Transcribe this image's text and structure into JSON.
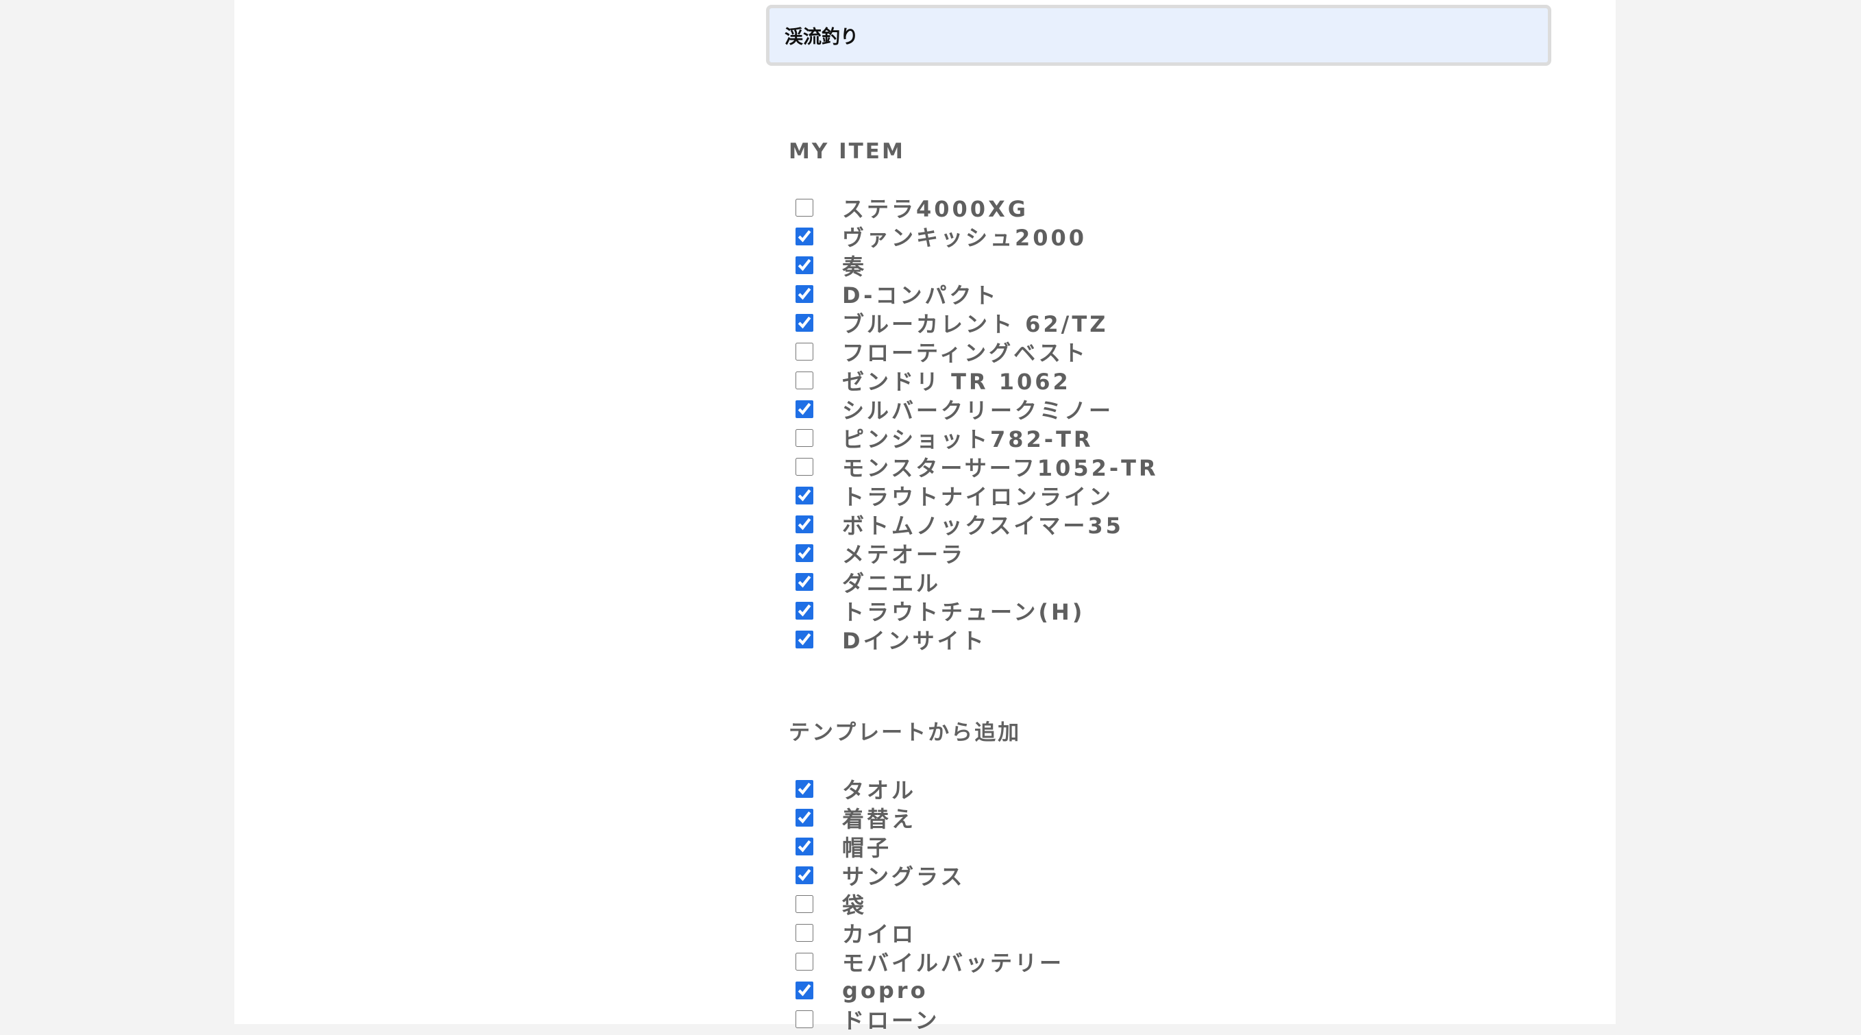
{
  "title_input": {
    "value": "渓流釣り"
  },
  "my_item": {
    "heading": "MY ITEM",
    "items": [
      {
        "label": "ステラ4000XG",
        "checked": false
      },
      {
        "label": "ヴァンキッシュ2000",
        "checked": true
      },
      {
        "label": "奏",
        "checked": true
      },
      {
        "label": "D-コンパクト",
        "checked": true
      },
      {
        "label": "ブルーカレント 62/TZ",
        "checked": true
      },
      {
        "label": "フローティングベスト",
        "checked": false
      },
      {
        "label": "ゼンドリ TR 1062",
        "checked": false
      },
      {
        "label": "シルバークリークミノー",
        "checked": true
      },
      {
        "label": "ピンショット782-TR",
        "checked": false
      },
      {
        "label": "モンスターサーフ1052-TR",
        "checked": false
      },
      {
        "label": "トラウトナイロンライン",
        "checked": true
      },
      {
        "label": "ボトムノックスイマー35",
        "checked": true
      },
      {
        "label": "メテオーラ",
        "checked": true
      },
      {
        "label": "ダニエル",
        "checked": true
      },
      {
        "label": "トラウトチューン(H)",
        "checked": true
      },
      {
        "label": "Dインサイト",
        "checked": true
      }
    ]
  },
  "template": {
    "heading": "テンプレートから追加",
    "items": [
      {
        "label": "タオル",
        "checked": true
      },
      {
        "label": "着替え",
        "checked": true
      },
      {
        "label": "帽子",
        "checked": true
      },
      {
        "label": "サングラス",
        "checked": true
      },
      {
        "label": "袋",
        "checked": false
      },
      {
        "label": "カイロ",
        "checked": false
      },
      {
        "label": "モバイルバッテリー",
        "checked": false
      },
      {
        "label": "gopro",
        "checked": true
      },
      {
        "label": "ドローン",
        "checked": false
      }
    ]
  },
  "colors": {
    "page_background": "#f3f3f3",
    "content_background": "#ffffff",
    "input_background": "#e8f0fd",
    "checkbox_accent": "#1f6fe5",
    "label_text": "#5f5f5f"
  }
}
